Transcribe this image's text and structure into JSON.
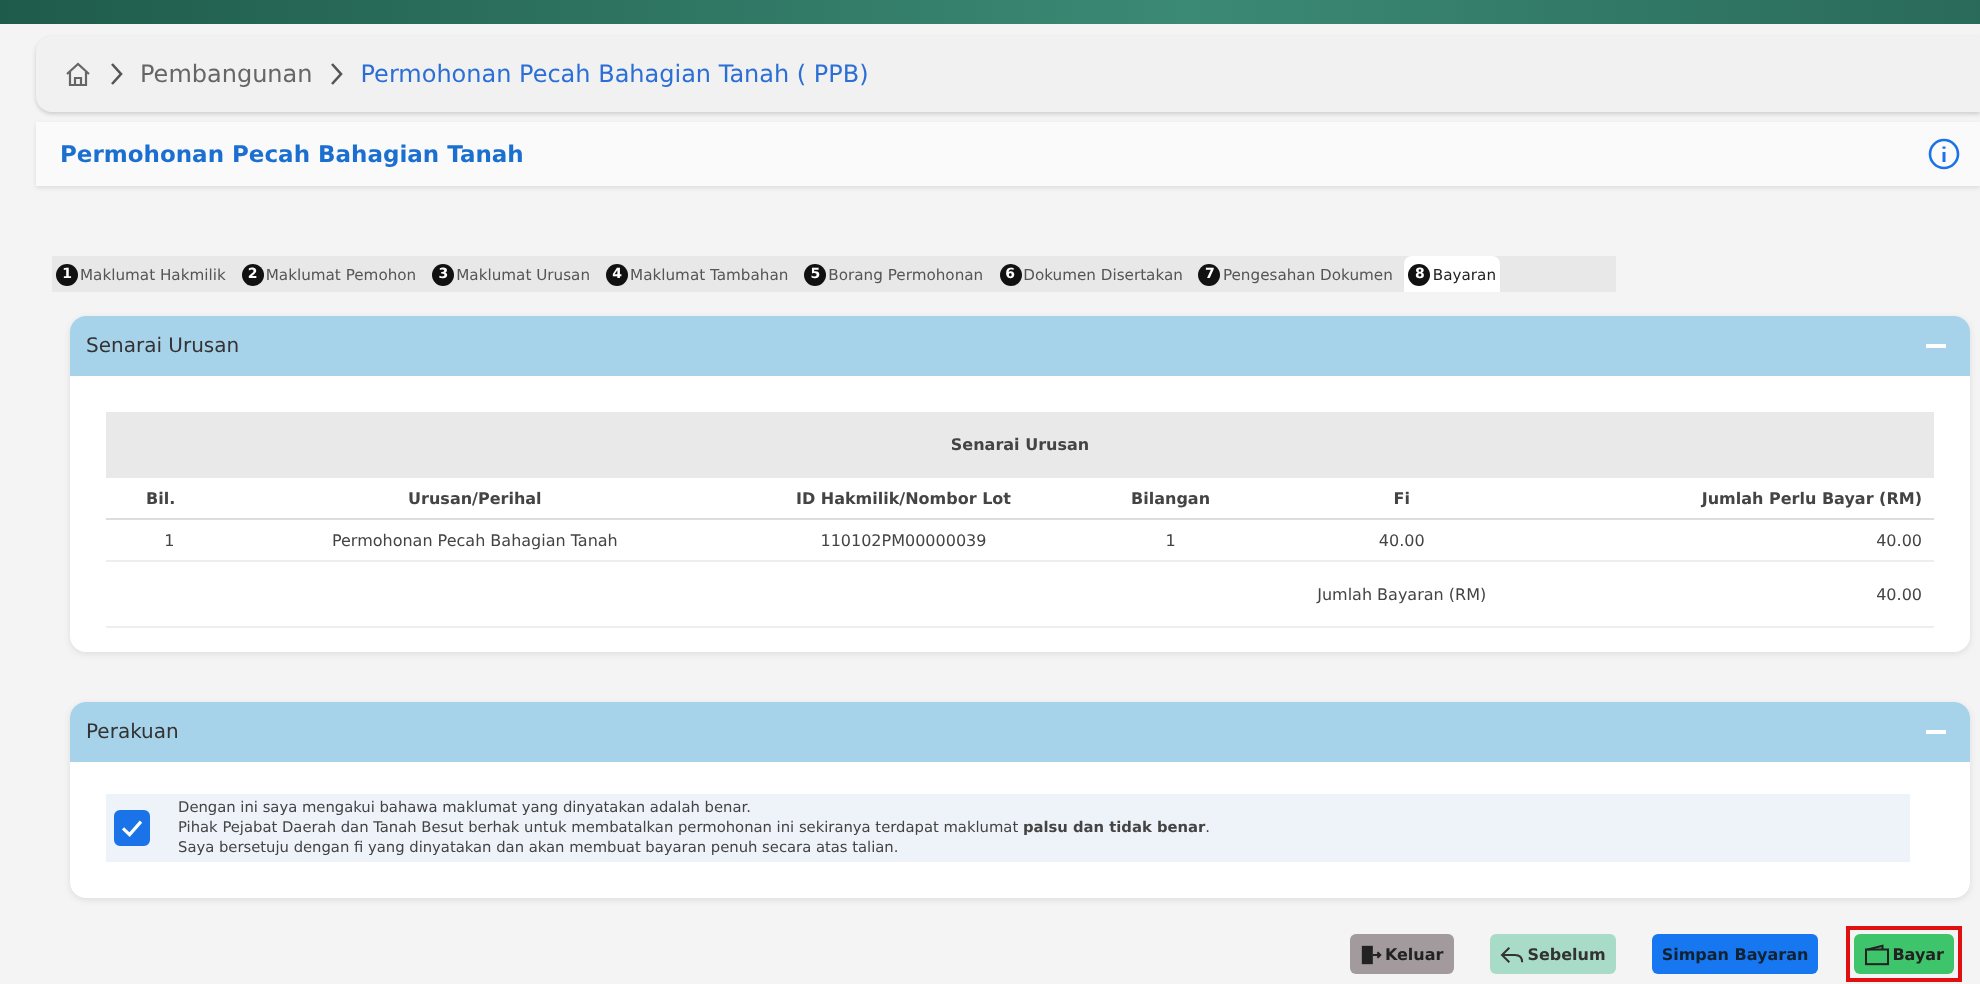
{
  "breadcrumb": {
    "items": [
      {
        "label": "Pembangunan",
        "current": false
      },
      {
        "label": "Permohonan Pecah Bahagian Tanah ( PPB)",
        "current": true
      }
    ]
  },
  "page_title": "Permohonan Pecah Bahagian Tanah",
  "tabs": [
    {
      "number": "1",
      "label": "Maklumat Hakmilik",
      "selected": false
    },
    {
      "number": "2",
      "label": "Maklumat Pemohon",
      "selected": false
    },
    {
      "number": "3",
      "label": "Maklumat Urusan",
      "selected": false
    },
    {
      "number": "4",
      "label": "Maklumat Tambahan",
      "selected": false
    },
    {
      "number": "5",
      "label": "Borang Permohonan",
      "selected": false
    },
    {
      "number": "6",
      "label": "Dokumen Disertakan",
      "selected": false
    },
    {
      "number": "7",
      "label": "Pengesahan Dokumen",
      "selected": false
    },
    {
      "number": "8",
      "label": "Bayaran",
      "selected": true
    }
  ],
  "senarai_panel": {
    "title": "Senarai Urusan",
    "table": {
      "caption": "Senarai Urusan",
      "columns": [
        "Bil.",
        "Urusan/Perihal",
        "ID Hakmilik/Nombor Lot",
        "Bilangan",
        "Fi",
        "Jumlah Perlu Bayar (RM)"
      ],
      "rows": [
        [
          "1",
          "Permohonan Pecah Bahagian Tanah",
          "110102PM00000039",
          "1",
          "40.00",
          "40.00"
        ]
      ],
      "total_label": "Jumlah Bayaran (RM)",
      "total_value": "40.00"
    }
  },
  "perakuan_panel": {
    "title": "Perakuan",
    "checked": true,
    "lines": [
      "Dengan ini saya mengakui bahawa maklumat yang dinyatakan adalah benar.",
      "Pihak Pejabat Daerah dan Tanah Besut berhak untuk membatalkan permohonan ini sekiranya terdapat maklumat **palsu dan tidak benar**.",
      "Saya bersetuju dengan fi yang dinyatakan dan akan membuat bayaran penuh secara atas talian."
    ]
  },
  "buttons": [
    {
      "kind": "exit",
      "label": "Keluar",
      "highlighted": false
    },
    {
      "kind": "back",
      "label": "Sebelum",
      "highlighted": false
    },
    {
      "kind": "save",
      "label": "Simpan Bayaran",
      "highlighted": false
    },
    {
      "kind": "pay",
      "label": "Bayar",
      "highlighted": true
    }
  ]
}
